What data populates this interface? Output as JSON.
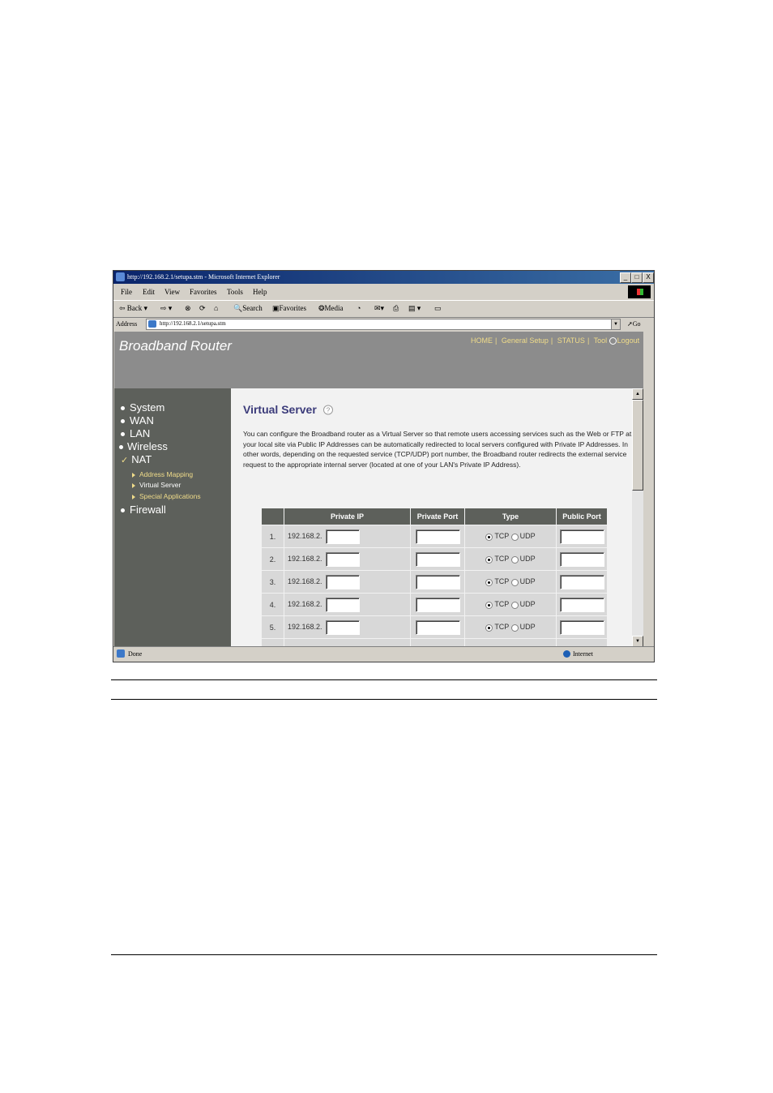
{
  "browser": {
    "title": "http://192.168.2.1/setupa.stm - Microsoft Internet Explorer",
    "menu": [
      "File",
      "Edit",
      "View",
      "Favorites",
      "Tools",
      "Help"
    ],
    "toolbar": {
      "back": "Back",
      "search": "Search",
      "favorites": "Favorites",
      "media": "Media"
    },
    "address_label": "Address",
    "address": "http://192.168.2.1/setupa.stm",
    "go": "Go",
    "status": "Done",
    "zone": "Internet",
    "min": "_",
    "max": "□",
    "close": "X"
  },
  "router": {
    "brand": "Broadband Router",
    "topnav": [
      "HOME",
      "General Setup",
      "STATUS",
      "Tool",
      "Logout"
    ],
    "sidebar": {
      "items": [
        "System",
        "WAN",
        "LAN",
        "Wireless",
        "NAT",
        "Firewall"
      ],
      "nat_sub": [
        "Address Mapping",
        "Virtual Server",
        "Special Applications"
      ]
    },
    "section_title": "Virtual Server",
    "description": "You can configure the Broadband router as a Virtual Server so that remote users accessing services such as the Web or FTP at your local site via Public IP Addresses can be automatically redirected to local servers configured with Private IP Addresses. In other words, depending on the requested service (TCP/UDP) port number, the Broadband router redirects the external service request to the appropriate internal server (located at one of your LAN's Private IP Address).",
    "table": {
      "headers": [
        "",
        "Private IP",
        "Private Port",
        "Type",
        "Public Port"
      ],
      "ip_prefix": "192.168.2.",
      "tcp": "TCP",
      "udp": "UDP",
      "rows": [
        "1.",
        "2.",
        "3.",
        "4.",
        "5."
      ]
    }
  }
}
